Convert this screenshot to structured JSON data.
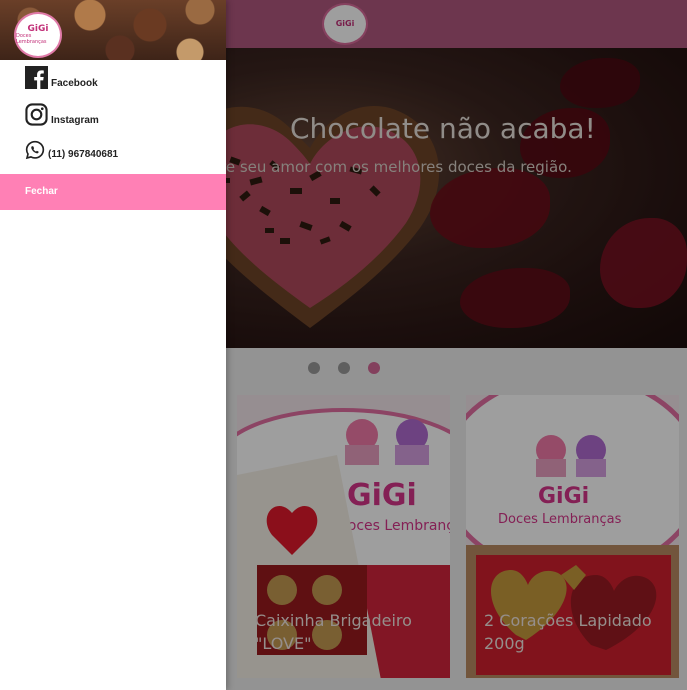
{
  "brand": {
    "logo_top": "GiGi",
    "logo_bottom": "Doces Lembranças",
    "color_primary": "#ff80b5",
    "color_topbar": "#b0577f"
  },
  "hero": {
    "title": "Chocolate não acaba!",
    "subtitle": "re seu amor com os melhores doces da região.",
    "slides": 3,
    "active_slide": 3
  },
  "products": [
    {
      "title": "Caixinha Brigadeiro \"LOVE\"",
      "image_text": "GiGi",
      "image_sub": "Doces Lembranças"
    },
    {
      "title": "2 Corações Lapidado 200g",
      "image_text": "GiGi",
      "image_sub": "Doces Lembranças"
    }
  ],
  "drawer": {
    "links": [
      {
        "icon": "facebook-icon",
        "label": "Facebook"
      },
      {
        "icon": "instagram-icon",
        "label": "Instagram"
      },
      {
        "icon": "whatsapp-icon",
        "label": "(11) 967840681"
      }
    ],
    "close_label": "Fechar"
  }
}
